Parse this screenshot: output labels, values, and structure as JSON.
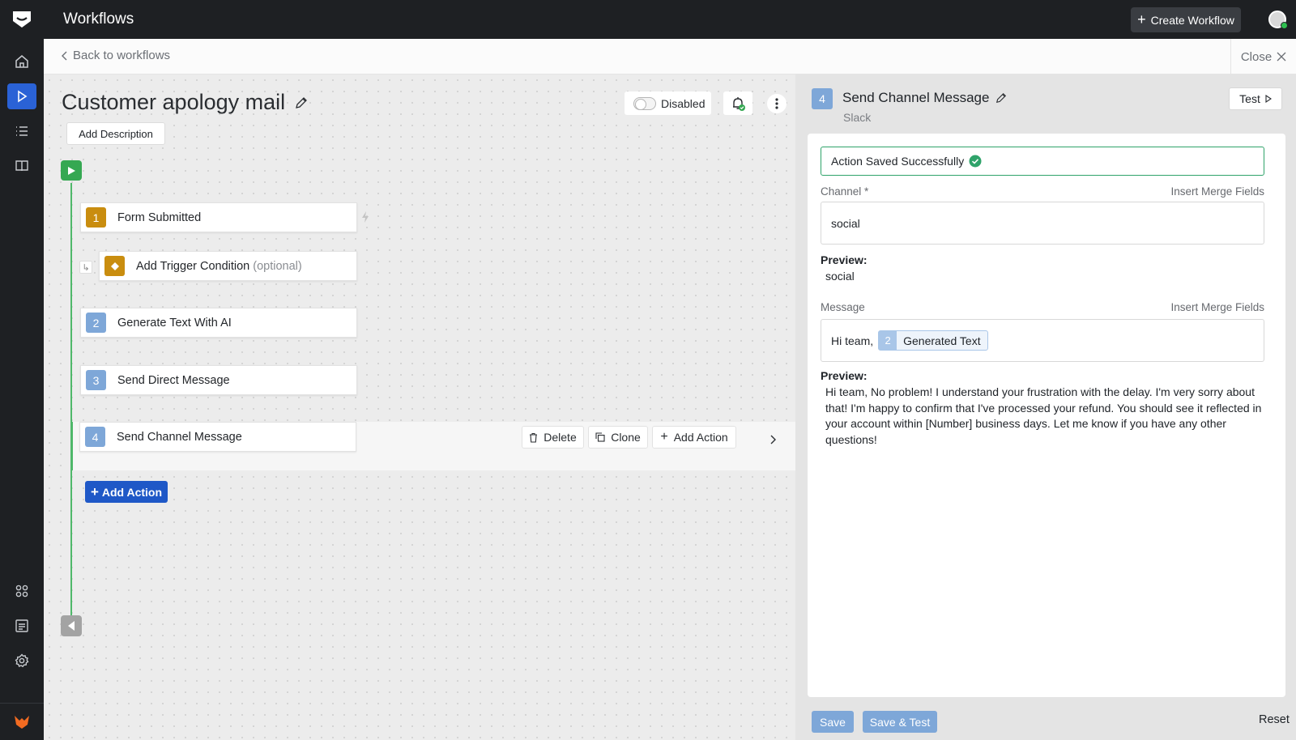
{
  "topbar": {
    "app_title": "Workflows",
    "create_label": "Create Workflow"
  },
  "rail": {
    "items": [
      "home-icon",
      "play-icon",
      "list-icon",
      "book-icon"
    ],
    "bottom_items": [
      "apps-icon",
      "document-icon",
      "settings-icon"
    ],
    "active": "play-icon"
  },
  "backbar": {
    "back_label": "Back to workflows",
    "close_label": "Close"
  },
  "workflow": {
    "title": "Customer apology mail",
    "add_description": "Add Description",
    "status_label": "Disabled"
  },
  "steps": {
    "trigger": {
      "number": "1",
      "label": "Form Submitted"
    },
    "condition": {
      "label": "Add Trigger Condition",
      "optional": "(optional)"
    },
    "step2": {
      "number": "2",
      "label": "Generate Text With AI"
    },
    "step3": {
      "number": "3",
      "label": "Send Direct Message"
    },
    "step4": {
      "number": "4",
      "label": "Send Channel Message"
    }
  },
  "row_actions": {
    "delete": "Delete",
    "clone": "Clone",
    "add_action": "Add Action"
  },
  "add_action_label": "Add Action",
  "panel": {
    "step_number": "4",
    "title": "Send Channel Message",
    "subtitle": "Slack",
    "test_label": "Test",
    "success_message": "Action Saved Successfully",
    "channel_label": "Channel *",
    "merge_fields": "Insert Merge Fields",
    "channel_value": "social",
    "preview_label": "Preview:",
    "channel_preview": "social",
    "message_label": "Message",
    "message_prefix": "Hi team,",
    "chip_number": "2",
    "chip_label": "Generated Text",
    "message_preview": "Hi team, No problem! I understand your frustration with the delay. I'm very sorry about that! I'm happy to confirm that I've processed your refund. You should see it reflected in your account within [Number] business days. Let me know if you have any other questions!",
    "save_label": "Save",
    "save_test_label": "Save & Test",
    "reset_label": "Reset"
  },
  "colors": {
    "primary": "#1f58c7",
    "success": "#35a852",
    "trigger": "#c98d0f",
    "action": "#7ea7d8",
    "dark": "#1e2023"
  }
}
